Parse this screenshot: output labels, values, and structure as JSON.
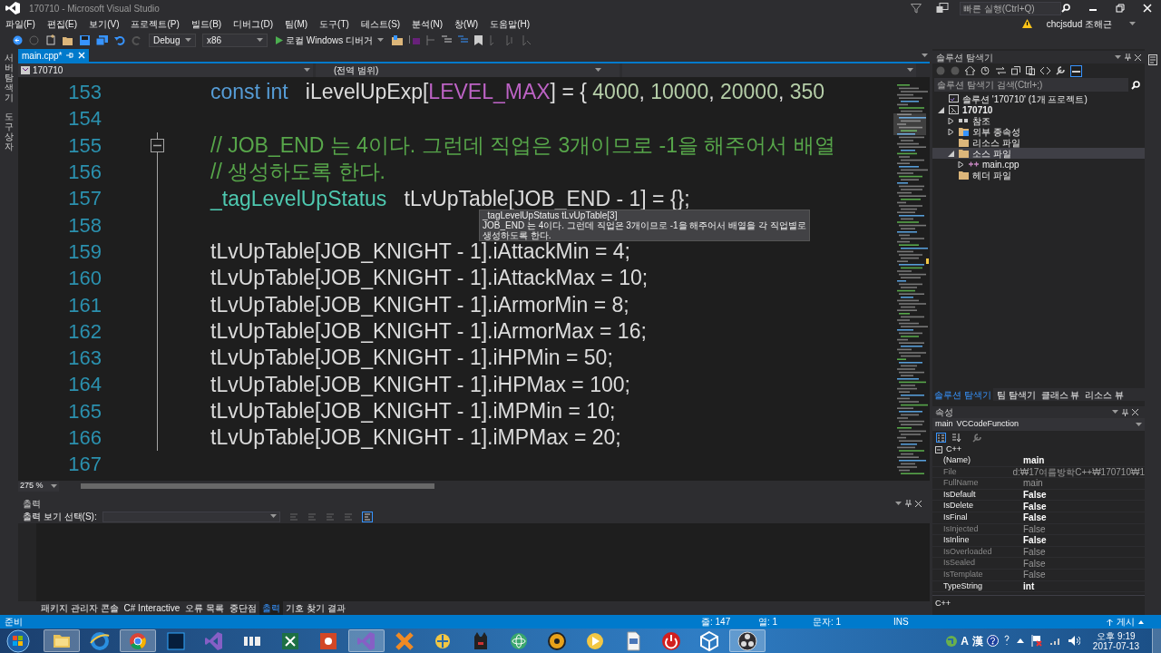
{
  "window": {
    "title": "170710 - Microsoft Visual Studio"
  },
  "quick_launch": {
    "placeholder": "빠른 실행(Ctrl+Q)"
  },
  "account": {
    "name": "chcjsdud 조해근"
  },
  "menu": [
    "파일(F)",
    "편집(E)",
    "보기(V)",
    "프로젝트(P)",
    "빌드(B)",
    "디버그(D)",
    "팀(M)",
    "도구(T)",
    "테스트(S)",
    "분석(N)",
    "창(W)",
    "도움말(H)"
  ],
  "toolbar": {
    "configuration": "Debug",
    "platform": "x86",
    "run_label": "로컬 Windows 디버거"
  },
  "left_strip": [
    "서버 탐색기",
    "도구 상자"
  ],
  "editor": {
    "tabs": [
      {
        "label": "main.cpp*",
        "selected": true
      }
    ],
    "project": "170710",
    "scope": "(전역 범위)",
    "zoom": "275 %",
    "lines": [
      {
        "number": "153",
        "collapse": false,
        "segments": [
          {
            "kind": "keyword",
            "text": "const int"
          },
          {
            "kind": "plain",
            "text": "   iLevelUpExp["
          },
          {
            "kind": "macro",
            "text": "LEVEL_MAX"
          },
          {
            "kind": "plain",
            "text": "] = { "
          },
          {
            "kind": "number",
            "text": "4000"
          },
          {
            "kind": "plain",
            "text": ", "
          },
          {
            "kind": "number",
            "text": "10000"
          },
          {
            "kind": "plain",
            "text": ", "
          },
          {
            "kind": "number",
            "text": "20000"
          },
          {
            "kind": "plain",
            "text": ", "
          },
          {
            "kind": "number",
            "text": "350"
          }
        ]
      },
      {
        "number": "154",
        "collapse": false
      },
      {
        "number": "155",
        "collapse": true,
        "segments": [
          {
            "kind": "comment",
            "text": "// JOB_END 는 4이다. 그런데 직업은 3개이므로 -1을 해주어서 배열"
          }
        ]
      },
      {
        "number": "156",
        "collapse": false,
        "segments": [
          {
            "kind": "comment",
            "text": "// 생성하도록 한다."
          }
        ]
      },
      {
        "number": "157",
        "collapse": false,
        "segments": [
          {
            "kind": "type",
            "text": "_tagLevelUpStatus"
          },
          {
            "kind": "plain",
            "text": "   tLvUpTable[JOB_END - 1] = {};"
          }
        ]
      },
      {
        "number": "158",
        "collapse": false
      },
      {
        "number": "159",
        "collapse": false,
        "segments": [
          {
            "kind": "plain",
            "text": "tLvUpTable[JOB_KNIGHT - 1].iAttackMin = 4;"
          }
        ]
      },
      {
        "number": "160",
        "collapse": false,
        "segments": [
          {
            "kind": "plain",
            "text": "tLvUpTable[JOB_KNIGHT - 1].iAttackMax = 10;"
          }
        ]
      },
      {
        "number": "161",
        "collapse": false,
        "segments": [
          {
            "kind": "plain",
            "text": "tLvUpTable[JOB_KNIGHT - 1].iArmorMin = 8;"
          }
        ]
      },
      {
        "number": "162",
        "collapse": false,
        "segments": [
          {
            "kind": "plain",
            "text": "tLvUpTable[JOB_KNIGHT - 1].iArmorMax = 16;"
          }
        ]
      },
      {
        "number": "163",
        "collapse": false,
        "segments": [
          {
            "kind": "plain",
            "text": "tLvUpTable[JOB_KNIGHT - 1].iHPMin = 50;"
          }
        ]
      },
      {
        "number": "164",
        "collapse": false,
        "segments": [
          {
            "kind": "plain",
            "text": "tLvUpTable[JOB_KNIGHT - 1].iHPMax = 100;"
          }
        ]
      },
      {
        "number": "165",
        "collapse": false,
        "segments": [
          {
            "kind": "plain",
            "text": "tLvUpTable[JOB_KNIGHT - 1].iMPMin = 10;"
          }
        ]
      },
      {
        "number": "166",
        "collapse": false,
        "segments": [
          {
            "kind": "plain",
            "text": "tLvUpTable[JOB_KNIGHT - 1].iMPMax = 20;"
          }
        ]
      },
      {
        "number": "167",
        "collapse": false
      }
    ],
    "tooltip": {
      "signature": "_tagLevelUpStatus tLvUpTable[3]",
      "lines": [
        "JOB_END 는 4이다. 그런데 직업은 3개이므로 -1을 해주어서 배열을 각 직업별로",
        "생성하도록 한다."
      ]
    }
  },
  "output": {
    "title": "출력",
    "source_label": "출력 보기 선택(S):",
    "tabs": [
      {
        "label": "패키지 관리자 콘솔",
        "selected": false
      },
      {
        "label": "C# Interactive",
        "selected": false
      },
      {
        "label": "오류 목록",
        "selected": false
      },
      {
        "label": "중단점",
        "selected": false
      },
      {
        "label": "출력",
        "selected": true
      },
      {
        "label": "기호 찾기 결과",
        "selected": false
      }
    ]
  },
  "solution_explorer": {
    "title": "솔루션 탐색기",
    "search": {
      "placeholder": "솔루션 탐색기 검색(Ctrl+;)"
    },
    "tree": [
      {
        "label": "솔루션 '170710' (1개 프로젝트)",
        "kind": "solution",
        "selected": false,
        "children": [
          {
            "label": "170710",
            "kind": "project",
            "expanded": true,
            "selected": false,
            "children": [
              {
                "label": "참조",
                "kind": "references",
                "expanded": false,
                "selected": false
              },
              {
                "label": "외부 종속성",
                "kind": "external",
                "expanded": false,
                "selected": false
              },
              {
                "label": "리소스 파일",
                "kind": "folder",
                "selected": false
              },
              {
                "label": "소스 파일",
                "kind": "folder",
                "expanded": true,
                "selected": true,
                "children": [
                  {
                    "label": "main.cpp",
                    "kind": "cpp",
                    "expanded": false,
                    "selected": false
                  }
                ]
              },
              {
                "label": "헤더 파일",
                "kind": "folder",
                "selected": false
              }
            ]
          }
        ]
      }
    ]
  },
  "explorer_tabs": [
    {
      "label": "솔루션 탐색기",
      "selected": true
    },
    {
      "label": "팀 탐색기",
      "selected": false
    },
    {
      "label": "클래스 뷰",
      "selected": false
    },
    {
      "label": "리소스 뷰",
      "selected": false
    }
  ],
  "properties": {
    "title": "속성",
    "object": "main",
    "object_type": "VCCodeFunction",
    "category": "C++",
    "rows": [
      {
        "name": "(Name)",
        "value": "main",
        "editable": true
      },
      {
        "name": "File",
        "value": "d:₩17여름방학C++₩170710₩1",
        "editable": false
      },
      {
        "name": "FullName",
        "value": "main",
        "editable": false
      },
      {
        "name": "IsDefault",
        "value": "False",
        "editable": true
      },
      {
        "name": "IsDelete",
        "value": "False",
        "editable": true
      },
      {
        "name": "IsFinal",
        "value": "False",
        "editable": true
      },
      {
        "name": "IsInjected",
        "value": "False",
        "editable": false
      },
      {
        "name": "IsInline",
        "value": "False",
        "editable": true
      },
      {
        "name": "IsOverloaded",
        "value": "False",
        "editable": false
      },
      {
        "name": "IsSealed",
        "value": "False",
        "editable": false
      },
      {
        "name": "IsTemplate",
        "value": "False",
        "editable": false
      },
      {
        "name": "TypeString",
        "value": "int",
        "editable": true
      }
    ],
    "description": "C++"
  },
  "status_bar": {
    "message": "준비",
    "line": "줄: 147",
    "column": "열: 1",
    "char": "문자: 1",
    "mode": "INS",
    "publish": "게시"
  },
  "taskbar": {
    "apps": [
      {
        "selected": true
      },
      {
        "selected": false
      },
      {
        "selected": true
      },
      {
        "selected": false
      },
      {
        "selected": false
      },
      {
        "selected": false
      },
      {
        "selected": false
      },
      {
        "selected": false
      },
      {
        "selected": true
      },
      {
        "selected": false
      },
      {
        "selected": false
      },
      {
        "selected": false
      },
      {
        "selected": false
      },
      {
        "selected": false
      },
      {
        "selected": false
      },
      {
        "selected": false
      },
      {
        "selected": false
      },
      {
        "selected": false
      },
      {
        "selected": true
      }
    ],
    "tray_text": [
      "A",
      "漢"
    ],
    "time": "오후 9:19",
    "date": "2017-07-13"
  }
}
